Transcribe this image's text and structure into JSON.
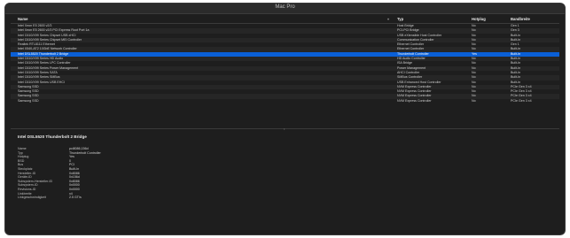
{
  "window": {
    "title": "Mac Pro"
  },
  "table": {
    "headers": {
      "name": "Name",
      "type": "Typ",
      "hotplug": "Hotplug",
      "bandwidth": "Bandbreite"
    },
    "rows": [
      {
        "name": "Intel Xeon E5 2600 v2/3",
        "type": "Host Bridge",
        "hotplug": "No",
        "bandwidth": "Gen 1"
      },
      {
        "name": "Intel Xeon E5 2600 v2/3 PCI Express Root Port 1a",
        "type": "PCI-PCI Bridge",
        "hotplug": "No",
        "bandwidth": "Gen 3"
      },
      {
        "name": "Intel C610/X99 Series Chipset USB xHCI",
        "type": "USB eXtensible Host Controller",
        "hotplug": "No",
        "bandwidth": "Built-In"
      },
      {
        "name": "Intel C610/X99 Series Chipset MEI Controller",
        "type": "Communication Controller",
        "hotplug": "No",
        "bandwidth": "Built-In"
      },
      {
        "name": "Realtek RTL8111 Ethernet",
        "type": "Ethernet Controller",
        "hotplug": "No",
        "bandwidth": "Gen 1"
      },
      {
        "name": "Intel X540-AT2 10GbE Network Controller",
        "type": "Ethernet Controller",
        "hotplug": "No",
        "bandwidth": "Built-In"
      },
      {
        "name": "Intel DSL5520 Thunderbolt 2 Bridge",
        "type": "Thunderbolt Controller",
        "hotplug": "Yes",
        "bandwidth": "Built-In",
        "selected": true
      },
      {
        "name": "Intel C610/X99 Series HD Audio",
        "type": "HD Audio Controller",
        "hotplug": "No",
        "bandwidth": "Built-In"
      },
      {
        "name": "Intel C610/X99 Series LPC Controller",
        "type": "ISA Bridge",
        "hotplug": "No",
        "bandwidth": "Built-In"
      },
      {
        "name": "Intel C610/X99 Series Power Management",
        "type": "Power Management",
        "hotplug": "No",
        "bandwidth": "Built-In"
      },
      {
        "name": "Intel C610/X99 Series SATA",
        "type": "AHCI Controller",
        "hotplug": "No",
        "bandwidth": "Built-In"
      },
      {
        "name": "Intel C610/X99 Series SMBus",
        "type": "SMBus Controller",
        "hotplug": "No",
        "bandwidth": "Built-In"
      },
      {
        "name": "Intel C610/X99 Series USB EHCI",
        "type": "USB Enhanced Host Controller",
        "hotplug": "No",
        "bandwidth": "Built-In"
      },
      {
        "name": "Samsung SSD",
        "type": "NVM Express Controller",
        "hotplug": "No",
        "bandwidth": "PCIe Gen 3 x4"
      },
      {
        "name": "Samsung SSD",
        "type": "NVM Express Controller",
        "hotplug": "No",
        "bandwidth": "PCIe Gen 3 x4"
      },
      {
        "name": "Samsung SSD",
        "type": "NVM Express Controller",
        "hotplug": "No",
        "bandwidth": "PCIe Gen 3 x4"
      },
      {
        "name": "Samsung SSD",
        "type": "NVM Express Controller",
        "hotplug": "No",
        "bandwidth": "PCIe Gen 3 x4"
      }
    ]
  },
  "detail": {
    "title": "Intel DSL5520 Thunderbolt 2 Bridge",
    "properties": [
      {
        "k": "Name",
        "v": "pci8086,156d"
      },
      {
        "k": "Typ",
        "v": "Thunderbolt Controller"
      },
      {
        "k": "Hotplug",
        "v": "Yes"
      },
      {
        "k": "BSD",
        "v": "0"
      },
      {
        "k": "Bus",
        "v": "PCI"
      },
      {
        "k": "Steckplatz",
        "v": "Built-In"
      },
      {
        "k": "Hersteller-ID",
        "v": "0x8086"
      },
      {
        "k": "Geräte-ID",
        "v": "0x156d"
      },
      {
        "k": "Subsystem-Hersteller-ID",
        "v": "0x8086"
      },
      {
        "k": "Subsystem-ID",
        "v": "0x0000"
      },
      {
        "k": "Revisions-ID",
        "v": "0x0000"
      },
      {
        "k": "Linkbreite",
        "v": "x4"
      },
      {
        "k": "Linkgeschwindigkeit",
        "v": "2.5 GT/s"
      }
    ]
  }
}
